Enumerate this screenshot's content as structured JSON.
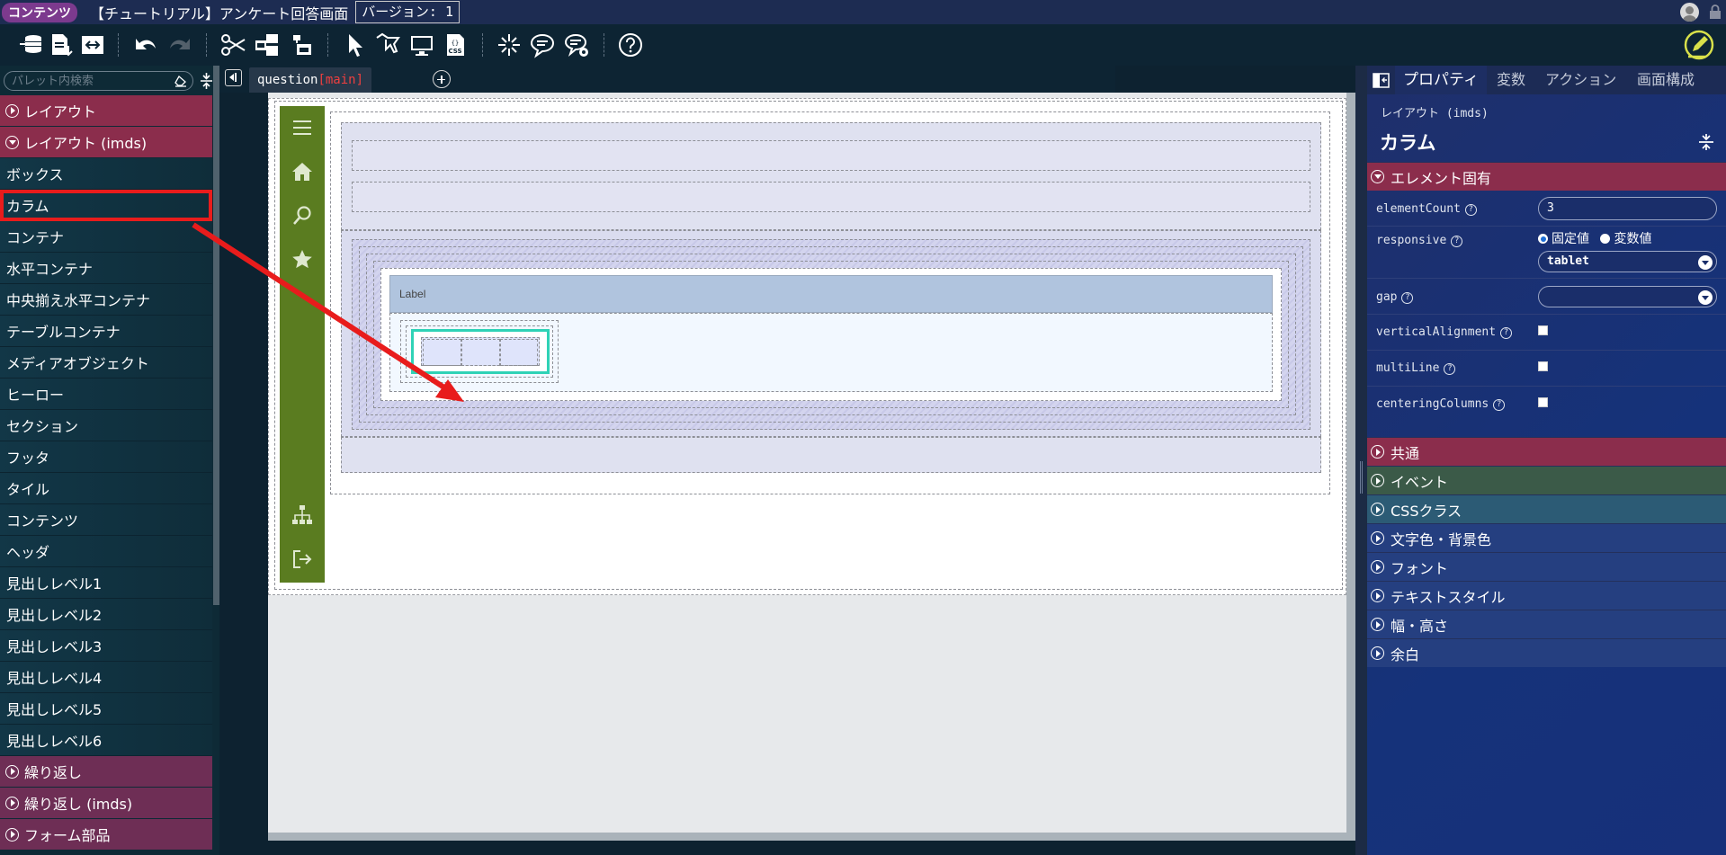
{
  "titlebar": {
    "badge": "コンテンツ",
    "screen_title": "【チュートリアル】アンケート回答画面",
    "version": "バージョン: 1"
  },
  "toolbar": {
    "icons": [
      "import-icon",
      "save-download-icon",
      "swap-icon",
      "undo-icon",
      "redo-icon",
      "cut-icon",
      "copy-component-icon",
      "paste-icon",
      "select-pointer-icon",
      "add-pointer-icon",
      "preview-monitor-icon",
      "css-icon",
      "spark-icon",
      "comment-icon",
      "comment-settings-icon",
      "help-icon",
      "edit-icon"
    ]
  },
  "palette": {
    "search_placeholder": "パレット内検索",
    "sections": [
      {
        "label": "レイアウト",
        "expanded": false
      },
      {
        "label": "レイアウト (imds)",
        "expanded": true
      }
    ],
    "items": [
      "ボックス",
      "カラム",
      "コンテナ",
      "水平コンテナ",
      "中央揃え水平コンテナ",
      "テーブルコンテナ",
      "メディアオブジェクト",
      "ヒーロー",
      "セクション",
      "フッタ",
      "タイル",
      "コンテンツ",
      "ヘッダ",
      "見出しレベル1",
      "見出しレベル2",
      "見出しレベル3",
      "見出しレベル4",
      "見出しレベル5",
      "見出しレベル6"
    ],
    "selected_item": "カラム",
    "footer_sections": [
      "繰り返し",
      "繰り返し (imds)",
      "フォーム部品"
    ]
  },
  "tabs": {
    "name": "question",
    "sub": "[main]"
  },
  "canvas": {
    "label_text": "Label"
  },
  "props": {
    "tabs": [
      "プロパティ",
      "変数",
      "アクション",
      "画面構成"
    ],
    "category": "レイアウト (imds)",
    "component_name": "カラム",
    "section_specific": "エレメント固有",
    "fields": {
      "elementCount": {
        "label": "elementCount",
        "value": "3"
      },
      "responsive": {
        "label": "responsive",
        "radio_fixed": "固定値",
        "radio_var": "変数値",
        "value": "tablet"
      },
      "gap": {
        "label": "gap",
        "value": ""
      },
      "verticalAlignment": {
        "label": "verticalAlignment"
      },
      "multiLine": {
        "label": "multiLine"
      },
      "centeringColumns": {
        "label": "centeringColumns"
      }
    },
    "sections": [
      "共通",
      "イベント",
      "CSSクラス",
      "文字色・背景色",
      "フォント",
      "テキストスタイル",
      "幅・高さ",
      "余白"
    ],
    "colors": {
      "common": "#8b2d4c",
      "event": "#3b5a48",
      "css": "#2c5b75",
      "others": "#253f80"
    }
  }
}
